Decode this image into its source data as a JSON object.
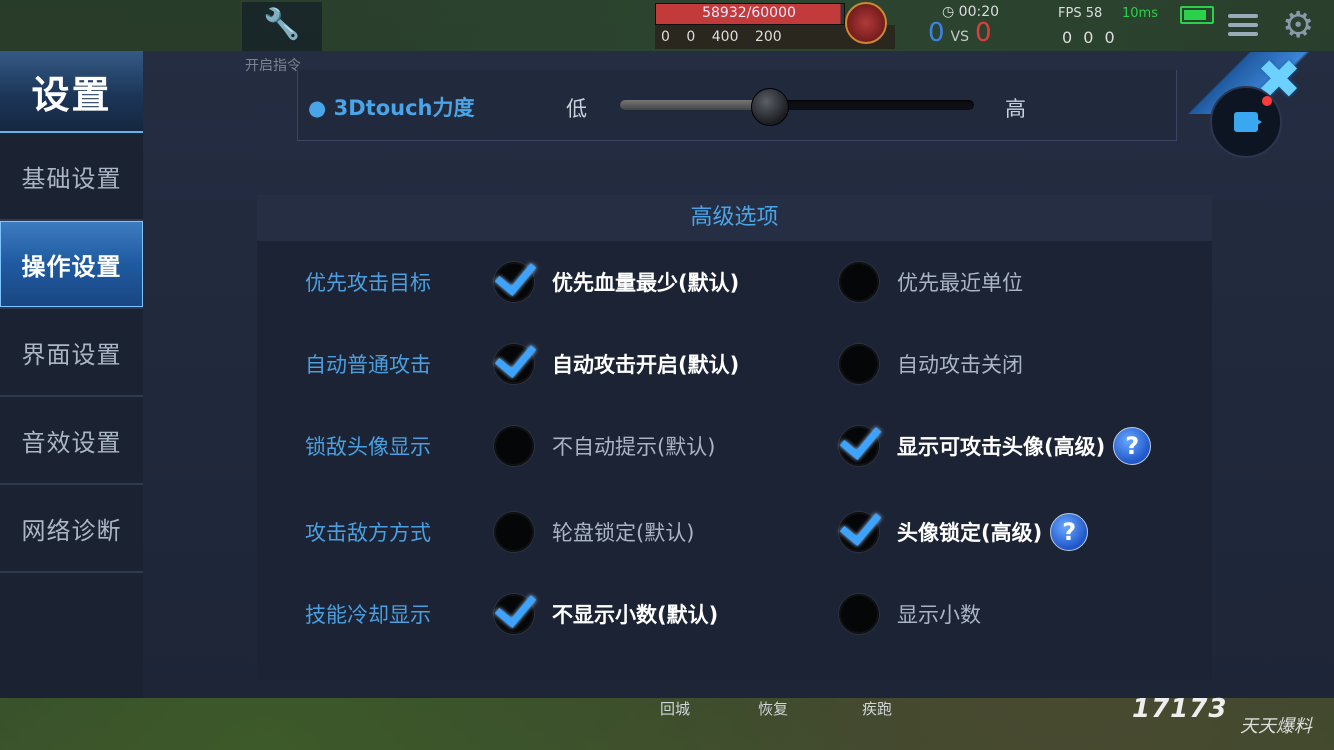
{
  "hud": {
    "hp_text": "58932/60000",
    "hp_progress": 0.982,
    "kills": "0",
    "assists": "0",
    "gold_a": "400",
    "gold_b": "200",
    "timer": "00:20",
    "score_blue": "0",
    "vs": "VS",
    "score_red": "0",
    "fps": "FPS 58",
    "ping": "10ms",
    "kda": "0 0 0",
    "hint": "开启指令"
  },
  "sidebar": {
    "title": "设置",
    "items": [
      {
        "label": "基础设置",
        "active": false
      },
      {
        "label": "操作设置",
        "active": true
      },
      {
        "label": "界面设置",
        "active": false
      },
      {
        "label": "音效设置",
        "active": false
      },
      {
        "label": "网络诊断",
        "active": false
      }
    ]
  },
  "touch": {
    "label": "3Dtouch力度",
    "low": "低",
    "high": "高",
    "value": 0.42
  },
  "advanced": {
    "title": "高级选项",
    "rows": [
      {
        "label": "优先攻击目标",
        "option_a": {
          "text": "优先血量最少(默认)",
          "checked": true,
          "help": false
        },
        "option_b": {
          "text": "优先最近单位",
          "checked": false,
          "help": false
        }
      },
      {
        "label": "自动普通攻击",
        "option_a": {
          "text": "自动攻击开启(默认)",
          "checked": true,
          "help": false
        },
        "option_b": {
          "text": "自动攻击关闭",
          "checked": false,
          "help": false
        }
      },
      {
        "label": "锁敌头像显示",
        "option_a": {
          "text": "不自动提示(默认)",
          "checked": false,
          "help": false
        },
        "option_b": {
          "text": "显示可攻击头像(高级)",
          "checked": true,
          "help": true
        }
      },
      {
        "label": "攻击敌方方式",
        "option_a": {
          "text": "轮盘锁定(默认)",
          "checked": false,
          "help": false
        },
        "option_b": {
          "text": "头像锁定(高级)",
          "checked": true,
          "help": true
        }
      },
      {
        "label": "技能冷却显示",
        "option_a": {
          "text": "不显示小数(默认)",
          "checked": true,
          "help": false
        },
        "option_b": {
          "text": "显示小数",
          "checked": false,
          "help": false
        }
      }
    ],
    "help_glyph": "?"
  },
  "bottom": {
    "skills": [
      "回城",
      "恢复",
      "疾跑"
    ],
    "logo": "17173",
    "watermark": "天天爆料"
  },
  "colors": {
    "accent": "#4aa4e8",
    "active_tab": "#1f5aa0",
    "check": "#3ea3ff"
  }
}
